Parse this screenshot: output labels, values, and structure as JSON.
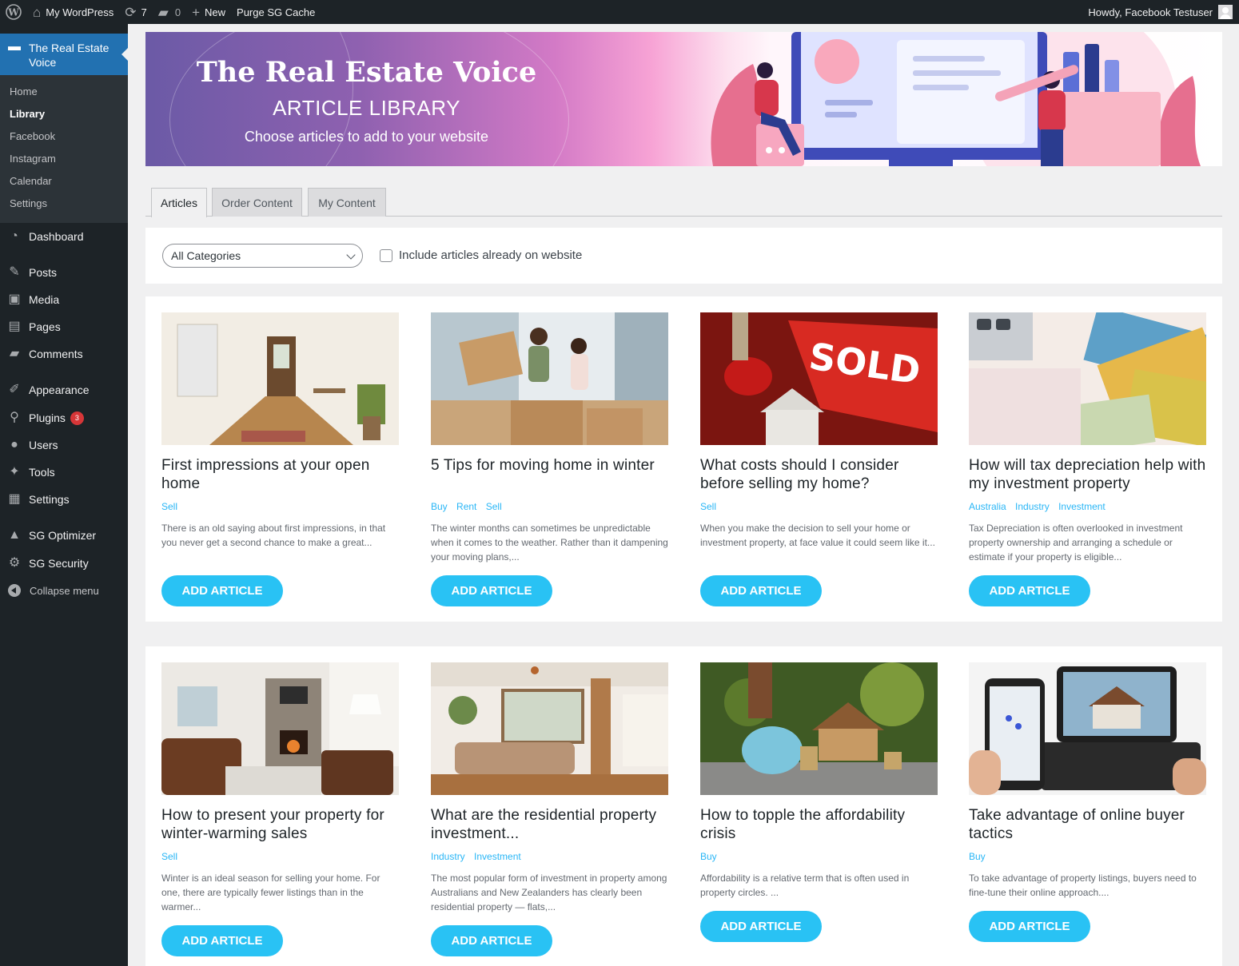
{
  "admin_bar": {
    "site_name": "My WordPress",
    "updates_count": "7",
    "comments_count": "0",
    "new_label": "New",
    "purge_label": "Purge SG Cache",
    "howdy": "Howdy, Facebook Testuser"
  },
  "sidebar": {
    "current": "The Real Estate Voice",
    "submenu": [
      "Home",
      "Library",
      "Facebook",
      "Instagram",
      "Calendar",
      "Settings"
    ],
    "active_submenu": "Library",
    "items": [
      {
        "label": "Dashboard",
        "icon": "dashboard-icon"
      },
      {
        "label": "Posts",
        "icon": "pin-icon"
      },
      {
        "label": "Media",
        "icon": "media-icon"
      },
      {
        "label": "Pages",
        "icon": "pages-icon"
      },
      {
        "label": "Comments",
        "icon": "comments-icon"
      },
      {
        "label": "Appearance",
        "icon": "brush-icon"
      },
      {
        "label": "Plugins",
        "icon": "plug-icon",
        "badge": "3"
      },
      {
        "label": "Users",
        "icon": "user-icon"
      },
      {
        "label": "Tools",
        "icon": "wrench-icon"
      },
      {
        "label": "Settings",
        "icon": "settings-icon"
      },
      {
        "label": "SG Optimizer",
        "icon": "sg-optimizer-icon"
      },
      {
        "label": "SG Security",
        "icon": "sg-security-icon"
      },
      {
        "label": "Collapse menu",
        "icon": "collapse-icon"
      }
    ]
  },
  "banner": {
    "title": "The Real Estate Voice",
    "subtitle": "ARTICLE LIBRARY",
    "tagline": "Choose articles to add to your website"
  },
  "tabs": [
    "Articles",
    "Order Content",
    "My Content"
  ],
  "active_tab": "Articles",
  "filter": {
    "category_value": "All Categories",
    "checkbox_label": "Include articles already on website",
    "checkbox_checked": false
  },
  "button_label": "ADD ARTICLE",
  "articles": [
    {
      "title": "First impressions at your open home",
      "tags": [
        "Sell"
      ],
      "excerpt": "There is an old saying about first impressions, in that you never get a second chance to make a great..."
    },
    {
      "title": "5 Tips for moving home in winter",
      "tags": [
        "Buy",
        "Rent",
        "Sell"
      ],
      "excerpt": "The winter months can sometimes be unpredictable when it comes to the weather. Rather than it dampening your moving plans,..."
    },
    {
      "title": "What costs should I consider before selling my home?",
      "tags": [
        "Sell"
      ],
      "excerpt": "When you make the decision to sell your home or investment property, at face value it could seem like it..."
    },
    {
      "title": "How will tax depreciation help with my investment property",
      "tags": [
        "Australia",
        "Industry",
        "Investment"
      ],
      "excerpt": "Tax Depreciation is often overlooked in investment property ownership and arranging a schedule or estimate if your property is eligible..."
    },
    {
      "title": "How to present your property for winter-warming sales",
      "tags": [
        "Sell"
      ],
      "excerpt": "Winter is an ideal season for selling your home. For one, there are typically fewer listings than in the warmer..."
    },
    {
      "title": "What are the residential property investment...",
      "tags": [
        "Industry",
        "Investment"
      ],
      "excerpt": "The most popular form of investment in property among Australians and New Zealanders has clearly been residential property — flats,..."
    },
    {
      "title": "How to topple the affordability crisis",
      "tags": [
        "Buy"
      ],
      "excerpt": "Affordability is a relative term that is often used in property circles. ..."
    },
    {
      "title": "Take advantage of online buyer tactics",
      "tags": [
        "Buy"
      ],
      "excerpt": "To take advantage of property listings, buyers need to fine-tune their online approach...."
    }
  ],
  "sold_sign_text": "SOLD",
  "colors": {
    "accent_button": "#29c2f4",
    "tag_color": "#29b6f6",
    "admin_blue": "#2271b1",
    "admin_dark": "#1d2327"
  }
}
